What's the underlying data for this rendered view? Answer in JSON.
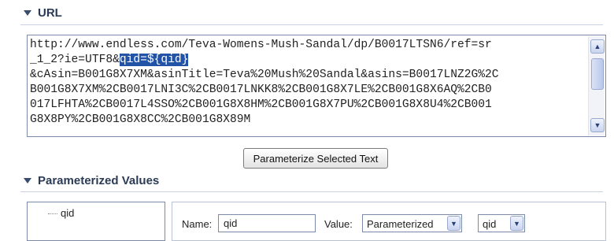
{
  "url_section": {
    "title": "URL",
    "url_lines": [
      {
        "before": "http://www.endless.com/Teva-Womens-Mush-Sandal/dp/B0017LTSN6/ref=sr",
        "selected": "",
        "after": ""
      },
      {
        "before": "_1_2?ie=UTF8&",
        "selected": "qid=${qid}",
        "after": ""
      },
      {
        "before": "&cAsin=B001G8X7XM&asinTitle=Teva%20Mush%20Sandal&asins=B0017LNZ2G%2C",
        "selected": "",
        "after": ""
      },
      {
        "before": "B001G8X7XM%2CB0017LNI3C%2CB0017LNKK8%2CB001G8X7LE%2CB001G8X6AQ%2CB0",
        "selected": "",
        "after": ""
      },
      {
        "before": "017LFHTA%2CB0017L4SSO%2CB001G8X8HM%2CB001G8X7PU%2CB001G8X8U4%2CB001",
        "selected": "",
        "after": ""
      },
      {
        "before": "G8X8PY%2CB001G8X8CC%2CB001G8X89M",
        "selected": "",
        "after": ""
      }
    ]
  },
  "parameterize_button": {
    "label": "Parameterize Selected Text"
  },
  "parameterized_section": {
    "title": "Parameterized Values",
    "list_items": [
      {
        "label": "qid"
      }
    ],
    "name_label": "Name:",
    "name_value": "qid",
    "value_label": "Value:",
    "value_select": "Parameterized",
    "param_select": "qid"
  },
  "icons": {
    "collapse": "triangle-down-icon",
    "scroll_up": "arrow-up-icon",
    "scroll_down": "arrow-down-icon",
    "dropdown": "chevron-down-icon"
  },
  "colors": {
    "selection": "#2353a7",
    "header_text": "#2b3b55",
    "border": "#7a8aa8"
  }
}
